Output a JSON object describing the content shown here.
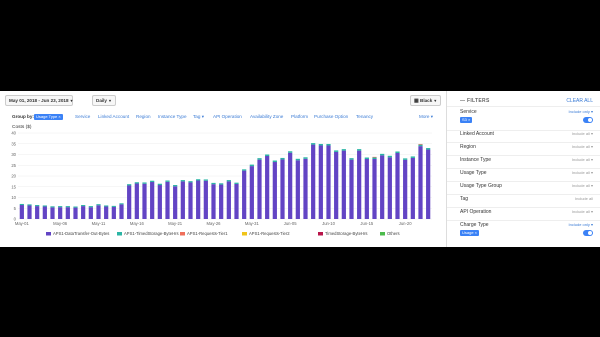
{
  "toolbar": {
    "date_range": "May 01, 2018 - Jun 23, 2018",
    "granularity": "Daily",
    "chart_style": "Black"
  },
  "group_by": {
    "label": "Group by:",
    "selected": "Usage Type",
    "options": [
      "Service",
      "Linked Account",
      "Region",
      "Instance Type",
      "Tag",
      "API Operation",
      "Availability Zone",
      "Platform",
      "Purchase Option",
      "Tenancy"
    ],
    "more": "More"
  },
  "filters": {
    "title": "FILTERS",
    "clear_all": "CLEAR ALL",
    "rows": [
      {
        "label": "Service",
        "mode": "Include only",
        "tag": "S3"
      },
      {
        "label": "Linked Account",
        "mode": "Include all"
      },
      {
        "label": "Region",
        "mode": "Include all"
      },
      {
        "label": "Instance Type",
        "mode": "Include all"
      },
      {
        "label": "Usage Type",
        "mode": "Include all"
      },
      {
        "label": "Usage Type Group",
        "mode": "Include all"
      },
      {
        "label": "Tag",
        "mode": "Include all"
      },
      {
        "label": "API Operation",
        "mode": "Include all"
      },
      {
        "label": "Charge Type",
        "mode": "Include only",
        "tag": "Usage"
      }
    ]
  },
  "chart_data": {
    "type": "bar",
    "stacked": true,
    "ylabel": "Costs ($)",
    "ylim": [
      0,
      40
    ],
    "yticks": [
      0,
      5,
      10,
      15,
      20,
      25,
      30,
      35,
      40
    ],
    "tick_labels": [
      "May-01",
      "May-06",
      "May-11",
      "May-16",
      "May-21",
      "May-26",
      "May-31",
      "Jun-05",
      "Jun-10",
      "Jun-15",
      "Jun-20"
    ],
    "tick_positions": [
      0,
      5,
      10,
      15,
      20,
      25,
      30,
      35,
      40,
      45,
      50
    ],
    "categories": [
      "May-01",
      "May-02",
      "May-03",
      "May-04",
      "May-05",
      "May-06",
      "May-07",
      "May-08",
      "May-09",
      "May-10",
      "May-11",
      "May-12",
      "May-13",
      "May-14",
      "May-15",
      "May-16",
      "May-17",
      "May-18",
      "May-19",
      "May-20",
      "May-21",
      "May-22",
      "May-23",
      "May-24",
      "May-25",
      "May-26",
      "May-27",
      "May-28",
      "May-29",
      "May-30",
      "May-31",
      "Jun-01",
      "Jun-02",
      "Jun-03",
      "Jun-04",
      "Jun-05",
      "Jun-06",
      "Jun-07",
      "Jun-08",
      "Jun-09",
      "Jun-10",
      "Jun-11",
      "Jun-12",
      "Jun-13",
      "Jun-14",
      "Jun-15",
      "Jun-16",
      "Jun-17",
      "Jun-18",
      "Jun-19",
      "Jun-20",
      "Jun-21",
      "Jun-22",
      "Jun-23"
    ],
    "series": [
      {
        "name": "APS1-DataTransfer-Out-Bytes",
        "color": "#6244c4",
        "values": [
          6.5,
          6.3,
          6.0,
          5.8,
          5.4,
          5.5,
          5.5,
          5.3,
          6.0,
          5.5,
          6.4,
          5.8,
          5.6,
          6.8,
          15.6,
          16.5,
          16.4,
          17.2,
          15.8,
          17.3,
          15.2,
          17.5,
          17.0,
          17.9,
          17.8,
          16.2,
          16.0,
          17.5,
          16.3,
          22.5,
          24.6,
          27.6,
          29.3,
          26.5,
          27.7,
          30.8,
          27.3,
          28.0,
          34.6,
          34.2,
          34.2,
          31.2,
          31.8,
          27.6,
          31.8,
          27.9,
          27.9,
          29.6,
          28.7,
          30.7,
          27.5,
          28.4,
          33.9,
          32.3
        ]
      },
      {
        "name": "APS1-TimedStorage-ByteHrs",
        "color": "#2bb5a5",
        "values": [
          0.5,
          0.5,
          0.5,
          0.5,
          0.5,
          0.5,
          0.5,
          0.5,
          0.5,
          0.5,
          0.5,
          0.5,
          0.5,
          0.5,
          0.6,
          0.6,
          0.6,
          0.6,
          0.6,
          0.6,
          0.6,
          0.6,
          0.6,
          0.6,
          0.6,
          0.6,
          0.6,
          0.6,
          0.6,
          0.6,
          0.7,
          0.7,
          0.7,
          0.7,
          0.7,
          0.7,
          0.7,
          0.7,
          0.7,
          0.7,
          0.7,
          0.7,
          0.7,
          0.7,
          0.7,
          0.7,
          0.7,
          0.7,
          0.7,
          0.7,
          0.7,
          0.7,
          0.7,
          0.7
        ]
      },
      {
        "name": "APS1-Requests-Tier1",
        "color": "#ef6f5b",
        "values": [
          0,
          0,
          0,
          0,
          0,
          0,
          0,
          0,
          0,
          0,
          0,
          0,
          0,
          0,
          0,
          0,
          0,
          0,
          0,
          0,
          0,
          0,
          0,
          0,
          0,
          0,
          0,
          0,
          0,
          0,
          0,
          0,
          0,
          0,
          0,
          0,
          0,
          0,
          0,
          0,
          0,
          0,
          0,
          0,
          0,
          0,
          0.3,
          0,
          0,
          0,
          0,
          0,
          0.3,
          0
        ]
      },
      {
        "name": "APS1-Requests-Tier2",
        "color": "#f0c419",
        "values": [
          0,
          0,
          0,
          0,
          0,
          0,
          0,
          0,
          0,
          0,
          0,
          0,
          0,
          0,
          0,
          0,
          0,
          0,
          0,
          0,
          0,
          0,
          0,
          0,
          0,
          0,
          0,
          0,
          0,
          0,
          0,
          0,
          0,
          0,
          0,
          0,
          0,
          0,
          0,
          0,
          0,
          0,
          0,
          0,
          0,
          0,
          0,
          0,
          0,
          0,
          0,
          0,
          0,
          0
        ]
      },
      {
        "name": "TimedStorage-ByteHrs",
        "color": "#b8154a",
        "values": [
          0,
          0,
          0,
          0,
          0,
          0,
          0,
          0,
          0,
          0,
          0,
          0,
          0,
          0,
          0,
          0,
          0,
          0,
          0,
          0,
          0,
          0,
          0,
          0,
          0,
          0,
          0,
          0,
          0,
          0,
          0,
          0,
          0,
          0,
          0,
          0,
          0,
          0,
          0,
          0,
          0,
          0,
          0,
          0,
          0,
          0,
          0,
          0,
          0,
          0,
          0,
          0,
          0,
          0
        ]
      },
      {
        "name": "Others",
        "color": "#4cbb4c",
        "values": [
          0,
          0,
          0,
          0,
          0,
          0,
          0,
          0,
          0,
          0,
          0,
          0,
          0,
          0,
          0,
          0,
          0,
          0,
          0,
          0,
          0,
          0,
          0,
          0,
          0,
          0,
          0,
          0,
          0,
          0,
          0,
          0,
          0,
          0,
          0,
          0,
          0,
          0,
          0,
          0,
          0,
          0,
          0,
          0,
          0,
          0,
          0,
          0,
          0,
          0,
          0,
          0,
          0,
          0
        ]
      }
    ]
  }
}
